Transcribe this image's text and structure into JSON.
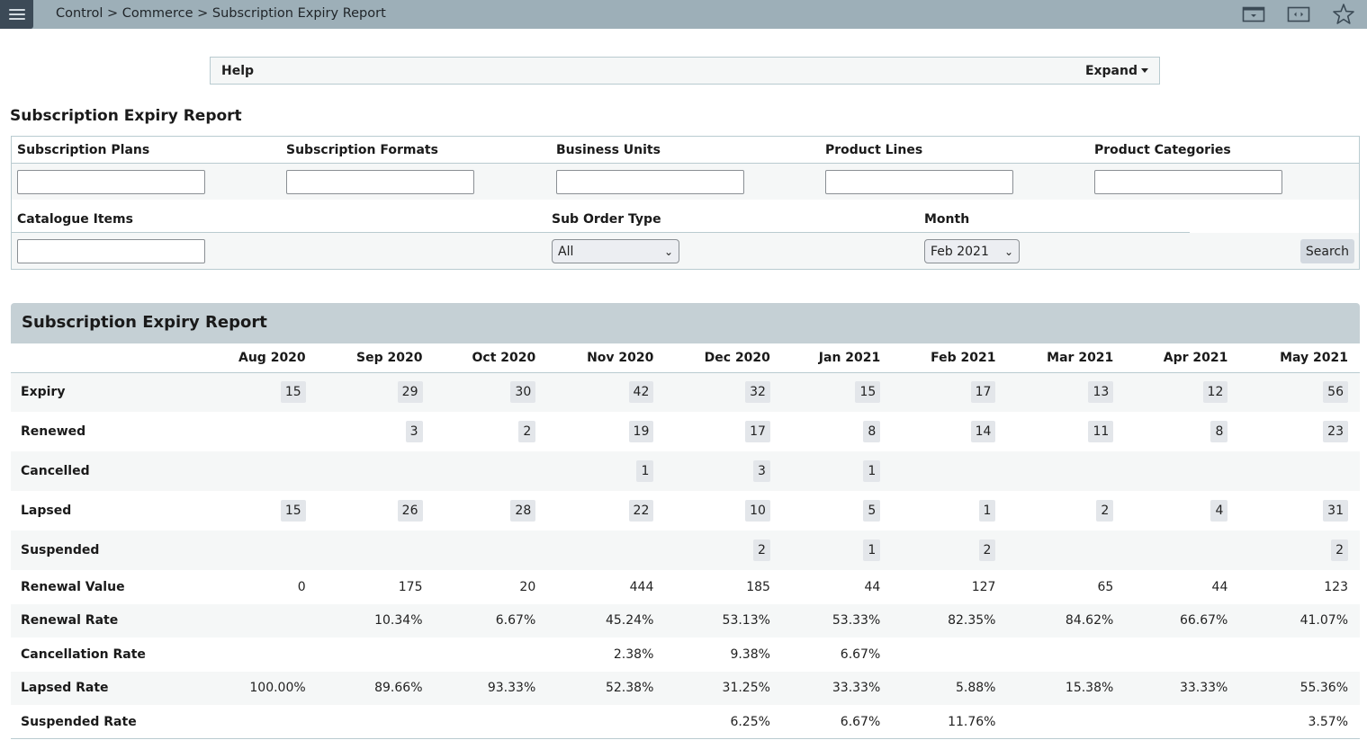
{
  "topbar": {
    "menu_icon": "hamburger-menu-icon",
    "breadcrumb": [
      "Control",
      "Commerce",
      "Subscription Expiry Report"
    ],
    "separator": ">",
    "icons": [
      "calendar-dropdown-icon",
      "expand-width-icon",
      "favorite-star-icon"
    ]
  },
  "help": {
    "label": "Help",
    "expand_label": "Expand"
  },
  "page_title": "Subscription Expiry Report",
  "filters": {
    "subscription_plans": {
      "label": "Subscription Plans",
      "value": ""
    },
    "subscription_formats": {
      "label": "Subscription Formats",
      "value": ""
    },
    "business_units": {
      "label": "Business Units",
      "value": ""
    },
    "product_lines": {
      "label": "Product Lines",
      "value": ""
    },
    "product_categories": {
      "label": "Product Categories",
      "value": ""
    },
    "catalogue_items": {
      "label": "Catalogue Items",
      "value": ""
    },
    "sub_order_type": {
      "label": "Sub Order Type",
      "selected": "All"
    },
    "month": {
      "label": "Month",
      "selected": "Feb 2021"
    },
    "search_label": "Search"
  },
  "report": {
    "title": "Subscription Expiry Report",
    "columns": [
      "Aug 2020",
      "Sep 2020",
      "Oct 2020",
      "Nov 2020",
      "Dec 2020",
      "Jan 2021",
      "Feb 2021",
      "Mar 2021",
      "Apr 2021",
      "May 2021"
    ],
    "count_rows": [
      {
        "label": "Expiry",
        "values": [
          "15",
          "29",
          "30",
          "42",
          "32",
          "15",
          "17",
          "13",
          "12",
          "56"
        ]
      },
      {
        "label": "Renewed",
        "values": [
          "",
          "3",
          "2",
          "19",
          "17",
          "8",
          "14",
          "11",
          "8",
          "23"
        ]
      },
      {
        "label": "Cancelled",
        "values": [
          "",
          "",
          "",
          "1",
          "3",
          "1",
          "",
          "",
          "",
          ""
        ]
      },
      {
        "label": "Lapsed",
        "values": [
          "15",
          "26",
          "28",
          "22",
          "10",
          "5",
          "1",
          "2",
          "4",
          "31"
        ]
      },
      {
        "label": "Suspended",
        "values": [
          "",
          "",
          "",
          "",
          "2",
          "1",
          "2",
          "",
          "",
          "2"
        ]
      }
    ],
    "metric_rows": [
      {
        "label": "Renewal Value",
        "values": [
          "0",
          "175",
          "20",
          "444",
          "185",
          "44",
          "127",
          "65",
          "44",
          "123"
        ]
      },
      {
        "label": "Renewal Rate",
        "values": [
          "",
          "10.34%",
          "6.67%",
          "45.24%",
          "53.13%",
          "53.33%",
          "82.35%",
          "84.62%",
          "66.67%",
          "41.07%"
        ]
      },
      {
        "label": "Cancellation Rate",
        "values": [
          "",
          "",
          "",
          "2.38%",
          "9.38%",
          "6.67%",
          "",
          "",
          "",
          ""
        ]
      },
      {
        "label": "Lapsed Rate",
        "values": [
          "100.00%",
          "89.66%",
          "93.33%",
          "52.38%",
          "31.25%",
          "33.33%",
          "5.88%",
          "15.38%",
          "33.33%",
          "55.36%"
        ]
      },
      {
        "label": "Suspended Rate",
        "values": [
          "",
          "",
          "",
          "",
          "6.25%",
          "6.67%",
          "11.76%",
          "",
          "",
          "3.57%"
        ]
      }
    ]
  }
}
